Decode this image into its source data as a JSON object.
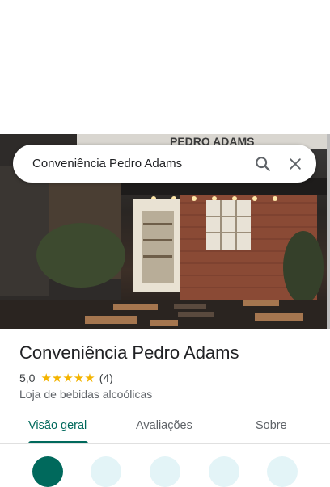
{
  "search": {
    "value": "Conveniência Pedro Adams"
  },
  "photo": {
    "sign_text": "PEDRO ADAMS"
  },
  "place": {
    "name": "Conveniência Pedro Adams",
    "rating": "5,0",
    "stars": "★★★★★",
    "review_count": "(4)",
    "category": "Loja de bebidas alcoólicas"
  },
  "tabs": [
    {
      "label": "Visão geral",
      "active": true
    },
    {
      "label": "Avaliações",
      "active": false
    },
    {
      "label": "Sobre",
      "active": false
    }
  ],
  "colors": {
    "accent": "#00695c",
    "star": "#f4b400",
    "action_light": "#e3f4f7"
  },
  "icons": {
    "search": "search-icon",
    "close": "close-icon"
  }
}
